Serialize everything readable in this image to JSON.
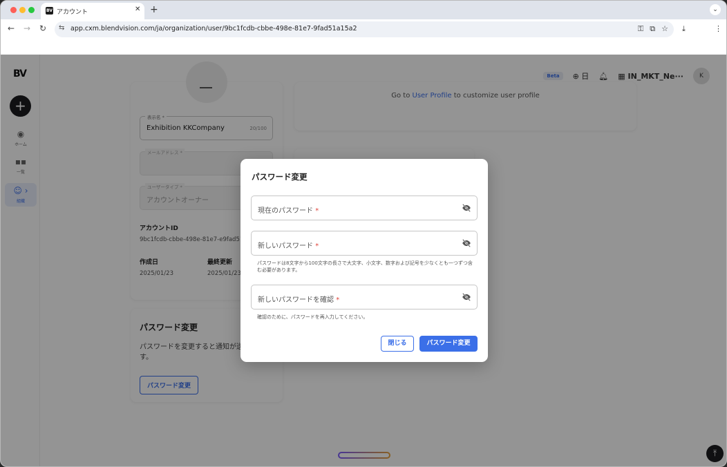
{
  "browser": {
    "tab_title": "アカウント",
    "favicon_text": "BV",
    "url": "app.cxm.blendvision.com/ja/organization/user/9bc1fcdb-cbbe-498e-81e7-9fad51a15a2",
    "traffic_colors": [
      "#fe5f57",
      "#febc2e",
      "#28c840"
    ]
  },
  "sidebar": {
    "logo": "BV",
    "items": [
      {
        "label": "ホーム"
      },
      {
        "label": "一覧"
      },
      {
        "label": "組織"
      }
    ]
  },
  "topbar": {
    "beta": "Beta",
    "language": "日",
    "org_name": "IN_MKT_Ne···",
    "avatar_initial": "K"
  },
  "account_card": {
    "display_name_label": "表示名",
    "display_name_value": "Exhibition KKCompany",
    "display_name_count": "20/100",
    "email_label": "メールアドレス",
    "user_type_label": "ユーザータイプ",
    "user_type_value": "アカウントオーナー",
    "account_id_label": "アカウントID",
    "account_id_value": "9bc1fcdb-cbbe-498e-81e7-e9fad51a",
    "created_label": "作成日",
    "created_value": "2025/01/23",
    "updated_label": "最終更新",
    "updated_value": "2025/01/23"
  },
  "password_card": {
    "title": "パスワード変更",
    "description": "パスワードを変更すると通知が送信されます。",
    "button": "パスワード変更"
  },
  "profile_hint": {
    "prefix": "Go to ",
    "link": "User Profile",
    "suffix": " to customize user profile"
  },
  "modal": {
    "title": "パスワード変更",
    "current_password": "現在のパスワード",
    "new_password": "新しいパスワード",
    "new_password_help": "パスワードは8文字から100文字の長さで大文字、小文字、数字および記号を少なくとも一つずつ含む必要があります。",
    "confirm_password": "新しいパスワードを確認",
    "confirm_help": "確認のために、パスワードを再入力してください。",
    "required_mark": "*",
    "close_button": "閉じる",
    "submit_button": "パスワード変更"
  },
  "colors": {
    "accent": "#3b6fe8",
    "required": "#e0443b"
  }
}
